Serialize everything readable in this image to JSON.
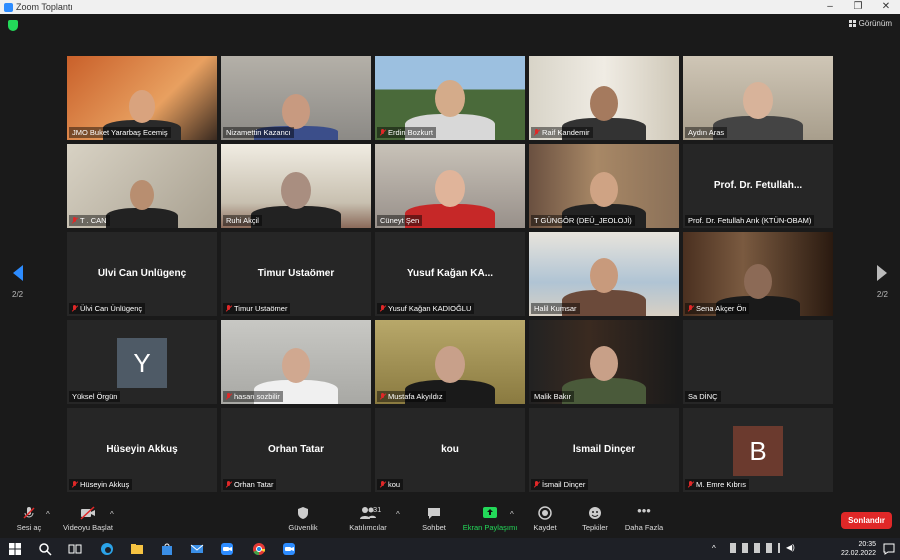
{
  "window": {
    "title": "Zoom Toplantı",
    "minimize": "–",
    "maximize": "❐",
    "close": "✕"
  },
  "topbar": {
    "view_label": "Görünüm"
  },
  "tiles": [
    {
      "name": "JMO Buket Yararbaş Ecemiş",
      "bigname": "",
      "video": true,
      "muted": false
    },
    {
      "name": "Nizamettin Kazancı",
      "bigname": "",
      "video": true,
      "muted": false
    },
    {
      "name": "Erdin Bozkurt",
      "bigname": "",
      "video": true,
      "muted": true
    },
    {
      "name": "Raif Kandemir",
      "bigname": "",
      "video": true,
      "muted": true
    },
    {
      "name": "Aydın Aras",
      "bigname": "",
      "video": true,
      "muted": false
    },
    {
      "name": "T . CAN",
      "bigname": "",
      "video": true,
      "muted": true
    },
    {
      "name": "Ruhi Akçil",
      "bigname": "",
      "video": true,
      "muted": false,
      "active": true
    },
    {
      "name": "Cüneyt Şen",
      "bigname": "",
      "video": true,
      "muted": false
    },
    {
      "name": "T GÜNGÖR (DEÜ_JEOLOJİ)",
      "bigname": "",
      "video": true,
      "muted": false
    },
    {
      "name": "Prof. Dr. Fetullah Arık (KTÜN-OBAM)",
      "bigname": "Prof. Dr. Fetullah...",
      "video": false,
      "muted": false
    },
    {
      "name": "Ülvi Can Ünlügenç",
      "bigname": "Ülvi Can Ünlügenç",
      "video": false,
      "muted": true
    },
    {
      "name": "Timur Ustaömer",
      "bigname": "Timur Ustaömer",
      "video": false,
      "muted": true
    },
    {
      "name": "Yusuf Kağan KADIOĞLU",
      "bigname": "Yusuf Kağan KA...",
      "video": false,
      "muted": true
    },
    {
      "name": "Halil Kumsar",
      "bigname": "",
      "video": true,
      "muted": false
    },
    {
      "name": "Sena Akçer Ön",
      "bigname": "",
      "video": true,
      "muted": true
    },
    {
      "name": "Yüksel Örgün",
      "bigname": "",
      "video": false,
      "muted": false,
      "avatar": "Y",
      "avatar_color": "#4e5a66"
    },
    {
      "name": "hasan sozbilir",
      "bigname": "",
      "video": true,
      "muted": true
    },
    {
      "name": "Mustafa Akyıldız",
      "bigname": "",
      "video": true,
      "muted": true
    },
    {
      "name": "Malik Bakır",
      "bigname": "",
      "video": true,
      "muted": false
    },
    {
      "name": "Sa DİNÇ",
      "bigname": "",
      "video": false,
      "muted": false
    },
    {
      "name": "Hüseyin Akkuş",
      "bigname": "Hüseyin Akkuş",
      "video": false,
      "muted": true
    },
    {
      "name": "Orhan Tatar",
      "bigname": "Orhan Tatar",
      "video": false,
      "muted": true
    },
    {
      "name": "kou",
      "bigname": "kou",
      "video": false,
      "muted": true
    },
    {
      "name": "İsmail Dinçer",
      "bigname": "İsmail Dinçer",
      "video": false,
      "muted": true
    },
    {
      "name": "M. Emre Kıbrıs",
      "bigname": "",
      "video": false,
      "muted": true,
      "avatar": "B",
      "avatar_color": "#6b3a2e"
    }
  ],
  "pager": {
    "left": "2/2",
    "right": "2/2"
  },
  "toolbar": {
    "mute": "Sesi aç",
    "video": "Videoyu Başlat",
    "security": "Güvenlik",
    "participants": "Katılımcılar",
    "participants_count": "31",
    "chat": "Sohbet",
    "share": "Ekran Paylaşımı",
    "record": "Kaydet",
    "reactions": "Tepkiler",
    "more": "Daha Fazla",
    "end": "Sonlandır"
  },
  "taskbar": {
    "time": "20:35",
    "date": "22.02.2022"
  }
}
